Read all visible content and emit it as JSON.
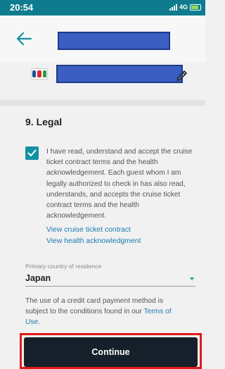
{
  "status_bar": {
    "time": "20:54",
    "network": "4G"
  },
  "legal": {
    "title": "9. Legal",
    "checkbox_checked": true,
    "acknowledgement_text": "I have read, understand and accept the cruise ticket contract terms and the health acknowledgement. Each guest whom I am legally authorized to check in has also read, understands, and accepts the cruise ticket contract terms and the health acknowledgement.",
    "view_contract_link": "View cruise ticket contract",
    "view_health_link": "View health acknowledgment"
  },
  "residence": {
    "label": "Primary country of residence",
    "value": "Japan"
  },
  "terms": {
    "text": "The use of a credit card payment method is subject to the conditions found in our",
    "link": "Terms of Use",
    "suffix": "."
  },
  "continue_label": "Continue",
  "colors": {
    "accent": "#1292a2",
    "link": "#1a7bb0",
    "button": "#15202b",
    "highlight": "#e01919",
    "status_bar": "#0e7c8e",
    "redaction": "#3a5ec2"
  },
  "icons": {
    "back": "arrow-left-icon",
    "edit": "pencil-icon",
    "card": "jcb-card-logo",
    "checkbox": "checkmark-icon",
    "dropdown": "caret-down-icon"
  }
}
